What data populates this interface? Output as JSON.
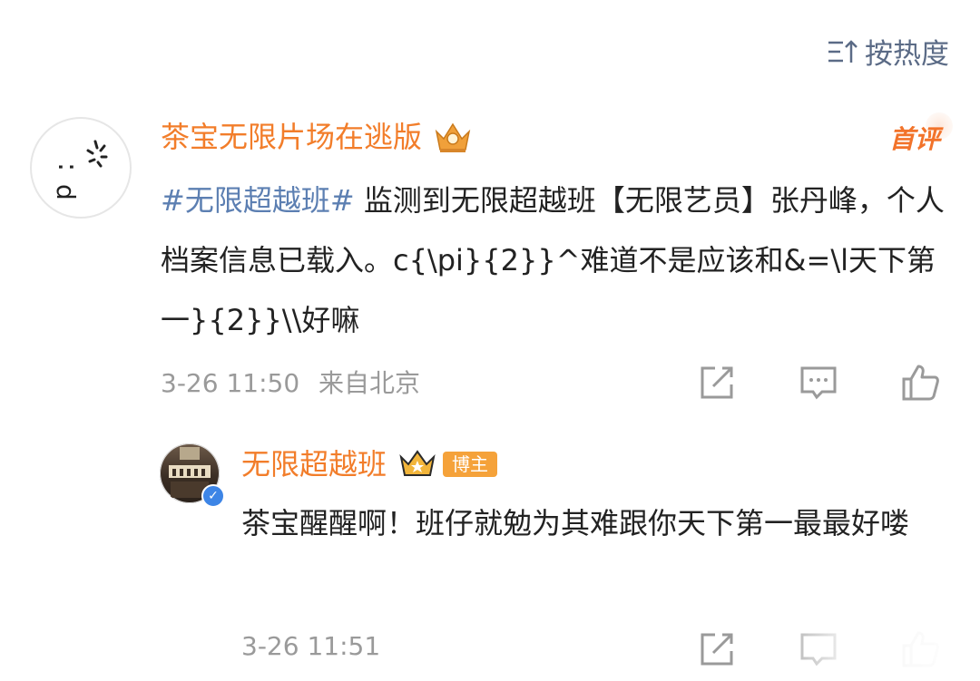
{
  "sort": {
    "label": "按热度",
    "icon": "sort-icon"
  },
  "comment": {
    "nickname": "茶宝无限片场在逃版",
    "badge": "首评",
    "topic": "#无限超越班#",
    "content": " 监测到无限超越班【无限艺员】张丹峰，个人档案信息已载入。c{\\pi}{2}}^难道不是应该和&=\\l天下第一}{2}}\\\\好嘛",
    "time": "3-26 11:50",
    "location": "来自北京"
  },
  "reply": {
    "nickname": "无限超越班",
    "tag": "博主",
    "content": "茶宝醒醒啊！班仔就勉为其难跟你天下第一最最好喽",
    "time": "3-26 11:51"
  },
  "colors": {
    "accent": "#f27d2a",
    "topic": "#5c7fb2",
    "meta": "#9a9a9a"
  },
  "icons": [
    "sort-icon",
    "crown-icon",
    "share-icon",
    "comment-icon",
    "like-icon",
    "verified-icon"
  ]
}
